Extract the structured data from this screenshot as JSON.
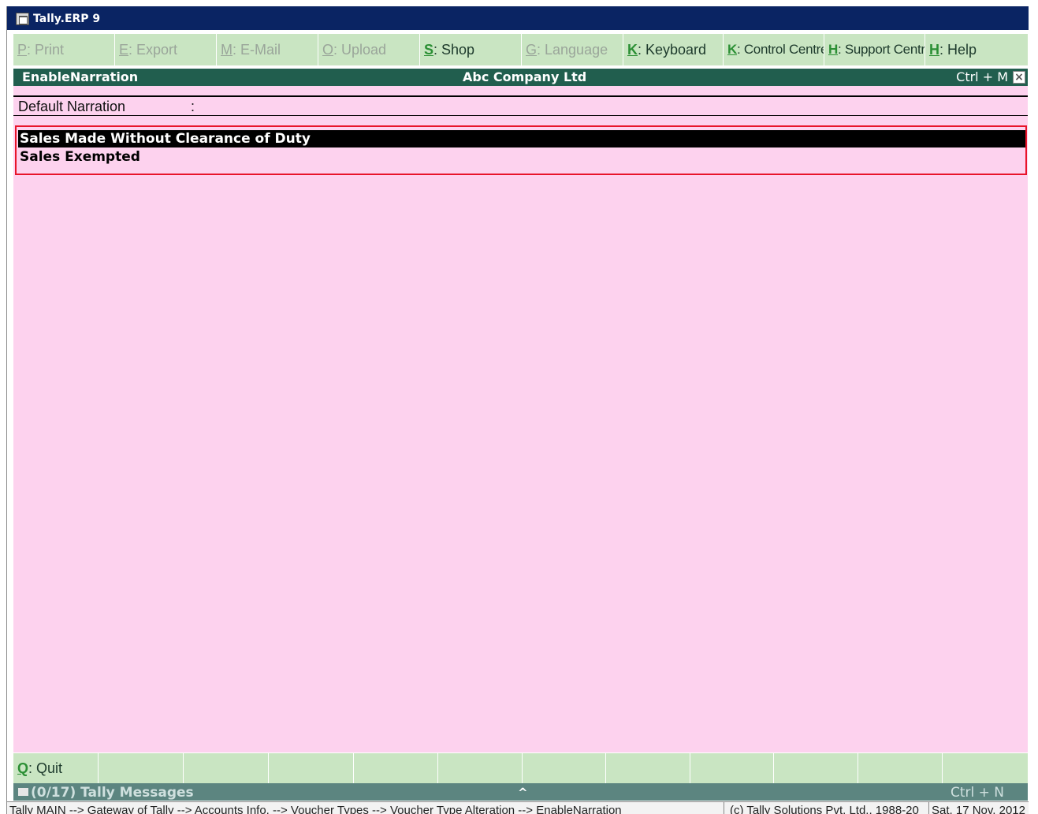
{
  "window": {
    "title": "Tally.ERP 9"
  },
  "topbar": {
    "buttons": [
      {
        "key": "P",
        "label": ": Print",
        "enabled": false
      },
      {
        "key": "E",
        "label": ": Export",
        "enabled": false
      },
      {
        "key": "M",
        "label": ": E-Mail",
        "enabled": false
      },
      {
        "key": "O",
        "label": ": Upload",
        "enabled": false
      },
      {
        "key": "S",
        "label": ": Shop",
        "enabled": true
      },
      {
        "key": "G",
        "label": ": Language",
        "enabled": false
      },
      {
        "key": "K",
        "label": ": Keyboard",
        "enabled": true
      },
      {
        "key": "K",
        "label": ": Control Centre",
        "enabled": true
      },
      {
        "key": "H",
        "label": ": Support Centre",
        "enabled": true
      },
      {
        "key": "H",
        "label": ": Help",
        "enabled": true
      }
    ]
  },
  "header": {
    "form_name": "EnableNarration",
    "company": "Abc Company Ltd",
    "shortcut": "Ctrl + M",
    "close_glyph": "×"
  },
  "form": {
    "default_narration_label": "Default Narration",
    "colon": ":",
    "default_narration_value": ""
  },
  "narration_list": {
    "items": [
      {
        "label": "Sales Made Without Clearance of Duty",
        "selected": true
      },
      {
        "label": "Sales Exempted",
        "selected": false
      }
    ]
  },
  "bottombar": {
    "quit": {
      "key": "Q",
      "label": ": Quit"
    }
  },
  "messages": {
    "text": "(0/17) Tally Messages",
    "caret": "^",
    "shortcut": "Ctrl + N"
  },
  "statusbar": {
    "path": "Tally MAIN --> Gateway of Tally --> Accounts Info. --> Voucher Types --> Voucher Type Alteration --> EnableNarration",
    "copyright": "(c) Tally Solutions Pvt. Ltd., 1988-20",
    "date": "Sat, 17 Nov, 2012"
  },
  "colors": {
    "titlebar": "#0a2463",
    "buttonbar": "#c9e5c2",
    "header": "#215e4e",
    "main_bg": "#fdd2ee",
    "list_border": "#e8142a",
    "selected_bg": "#000000",
    "messages_bar": "#5c8580"
  }
}
